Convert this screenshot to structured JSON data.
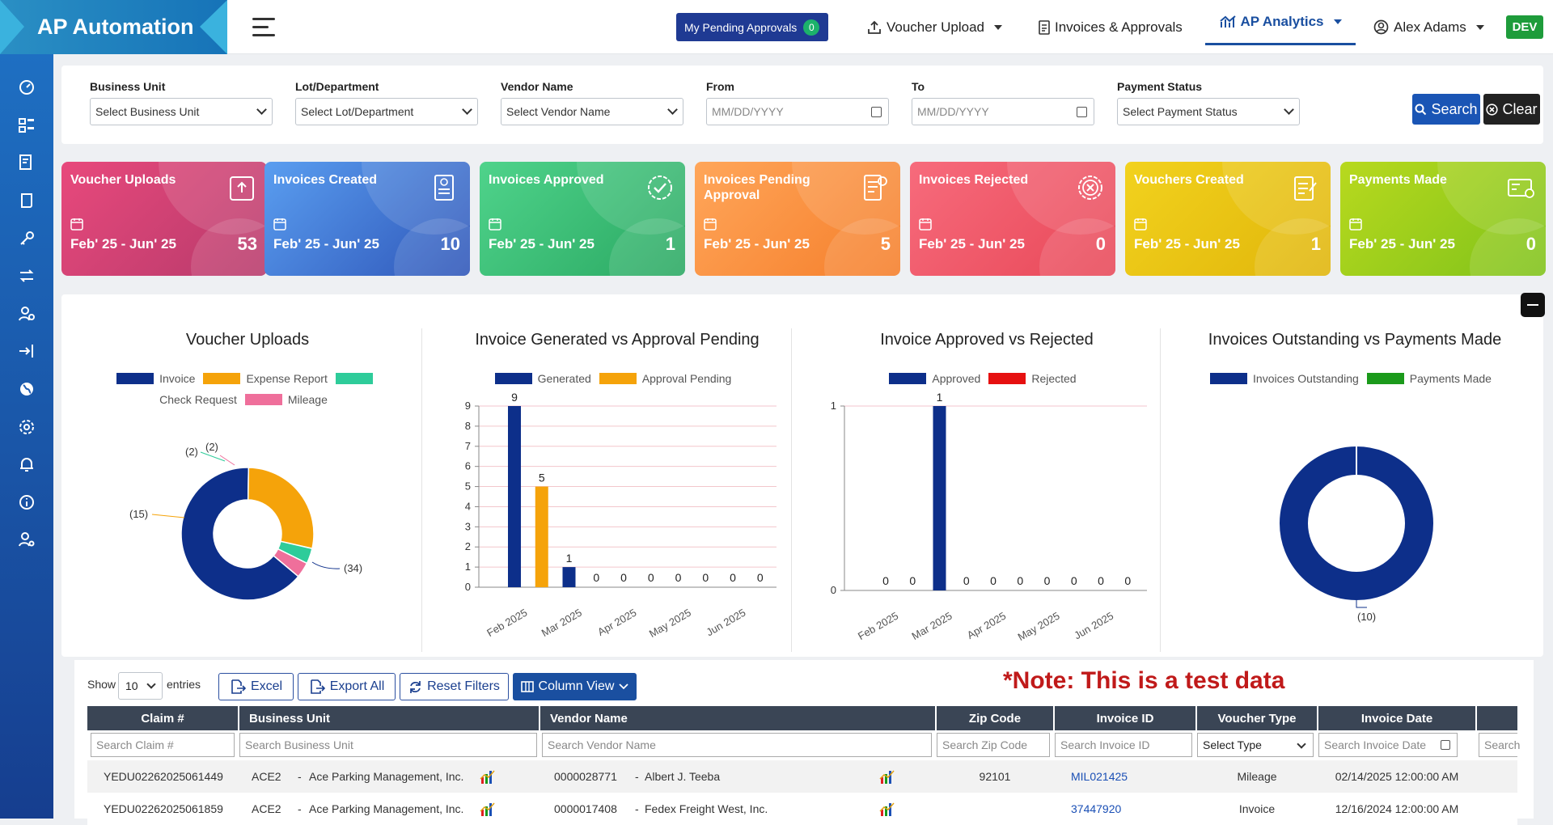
{
  "app": {
    "brand": "AP Automation",
    "env_badge": "DEV"
  },
  "header": {
    "pending_approvals": {
      "label": "My Pending Approvals",
      "count": "0"
    },
    "nav": [
      "Voucher Upload",
      "Invoices & Approvals",
      "AP Analytics",
      "Alex Adams"
    ]
  },
  "filters": {
    "business_unit": {
      "label": "Business Unit",
      "value": "Select Business Unit"
    },
    "lot": {
      "label": "Lot/Department",
      "value": "Select Lot/Department"
    },
    "vendor": {
      "label": "Vendor Name",
      "value": "Select Vendor Name"
    },
    "from": {
      "label": "From",
      "placeholder": "MM/DD/YYYY"
    },
    "to": {
      "label": "To",
      "placeholder": "MM/DD/YYYY"
    },
    "payment_status": {
      "label": "Payment Status",
      "value": "Select Payment Status"
    },
    "search_label": "Search",
    "clear_label": "Clear"
  },
  "cards": [
    {
      "title": "Voucher Uploads",
      "range": "Feb' 25 - Jun' 25",
      "value": "53"
    },
    {
      "title": "Invoices Created",
      "range": "Feb' 25 - Jun' 25",
      "value": "10"
    },
    {
      "title": "Invoices Approved",
      "range": "Feb' 25 - Jun' 25",
      "value": "1"
    },
    {
      "title": "Invoices Pending Approval",
      "range": "Feb' 25 - Jun' 25",
      "value": "5"
    },
    {
      "title": "Invoices Rejected",
      "range": "Feb' 25 - Jun' 25",
      "value": "0"
    },
    {
      "title": "Vouchers Created",
      "range": "Feb' 25 - Jun' 25",
      "value": "1"
    },
    {
      "title": "Payments Made",
      "range": "Feb' 25 - Jun' 25",
      "value": "0"
    }
  ],
  "chart_data": [
    {
      "type": "pie",
      "title": "Voucher Uploads",
      "categories": [
        "Invoice",
        "Expense Report",
        "Check Request",
        "Mileage"
      ],
      "values": [
        34,
        15,
        2,
        2
      ],
      "data_labels": [
        "(34)",
        "(15)",
        "(2)",
        "(2)"
      ],
      "colors": [
        "#0d2f8a",
        "#f5a30a",
        "#2ecc9a",
        "#ef6f9b"
      ],
      "legend": "top"
    },
    {
      "type": "bar",
      "title": "Invoice Generated vs Approval Pending",
      "categories": [
        "Feb 2025",
        "Mar 2025",
        "Apr 2025",
        "May 2025",
        "Jun 2025"
      ],
      "series": [
        {
          "name": "Generated",
          "values": [
            9,
            1,
            0,
            0,
            0
          ]
        },
        {
          "name": "Approval Pending",
          "values": [
            5,
            0,
            0,
            0,
            0
          ]
        }
      ],
      "colors": [
        "#0d2f8a",
        "#f5a30a"
      ],
      "ylim": [
        0,
        9
      ],
      "yticks": [
        "0",
        "1",
        "2",
        "3",
        "4",
        "5",
        "6",
        "7",
        "8",
        "9"
      ],
      "legend": "top"
    },
    {
      "type": "bar",
      "title": "Invoice Approved vs Rejected",
      "categories": [
        "Feb 2025",
        "Mar 2025",
        "Apr 2025",
        "May 2025",
        "Jun 2025"
      ],
      "series": [
        {
          "name": "Approved",
          "values": [
            0,
            1,
            0,
            0,
            0
          ]
        },
        {
          "name": "Rejected",
          "values": [
            0,
            0,
            0,
            0,
            0
          ]
        }
      ],
      "colors": [
        "#0d2f8a",
        "#e61010"
      ],
      "ylim": [
        0,
        1
      ],
      "yticks": [
        "0",
        "1"
      ],
      "legend": "top"
    },
    {
      "type": "pie",
      "title": "Invoices Outstanding vs Payments Made",
      "categories": [
        "Invoices Outstanding",
        "Payments Made"
      ],
      "values": [
        10,
        0
      ],
      "data_labels": [
        "(10)"
      ],
      "colors": [
        "#0d2f8a",
        "#1b9a1b"
      ],
      "legend": "top"
    }
  ],
  "table": {
    "show_label": "Show",
    "entries_value": "10",
    "entries_label": "entries",
    "buttons": [
      "Excel",
      "Export All",
      "Reset Filters",
      "Column View"
    ],
    "note": "*Note: This is a test data",
    "columns": [
      "Claim #",
      "Business Unit",
      "Vendor Name",
      "Zip Code",
      "Invoice ID",
      "Voucher Type",
      "Invoice Date"
    ],
    "filter_placeholders": [
      "Search Claim #",
      "Search Business Unit",
      "Search Vendor Name",
      "Search Zip Code",
      "Search Invoice ID",
      "Select Type",
      "Search Invoice Date",
      "Search"
    ],
    "rows": [
      {
        "claim": "YEDU02262025061449",
        "bu_code": "ACE2",
        "bu_name": "Ace Parking Management, Inc.",
        "vendor_code": "0000028771",
        "vendor_name": "Albert J. Teeba",
        "zip": "92101",
        "invoice_id": "MIL021425",
        "type": "Mileage",
        "date": "02/14/2025 12:00:00 AM"
      },
      {
        "claim": "YEDU02262025061859",
        "bu_code": "ACE2",
        "bu_name": "Ace Parking Management, Inc.",
        "vendor_code": "0000017408",
        "vendor_name": "Fedex Freight West, Inc.",
        "zip": "",
        "invoice_id": "37447920",
        "type": "Invoice",
        "date": "12/16/2024 12:00:00 AM"
      }
    ]
  }
}
